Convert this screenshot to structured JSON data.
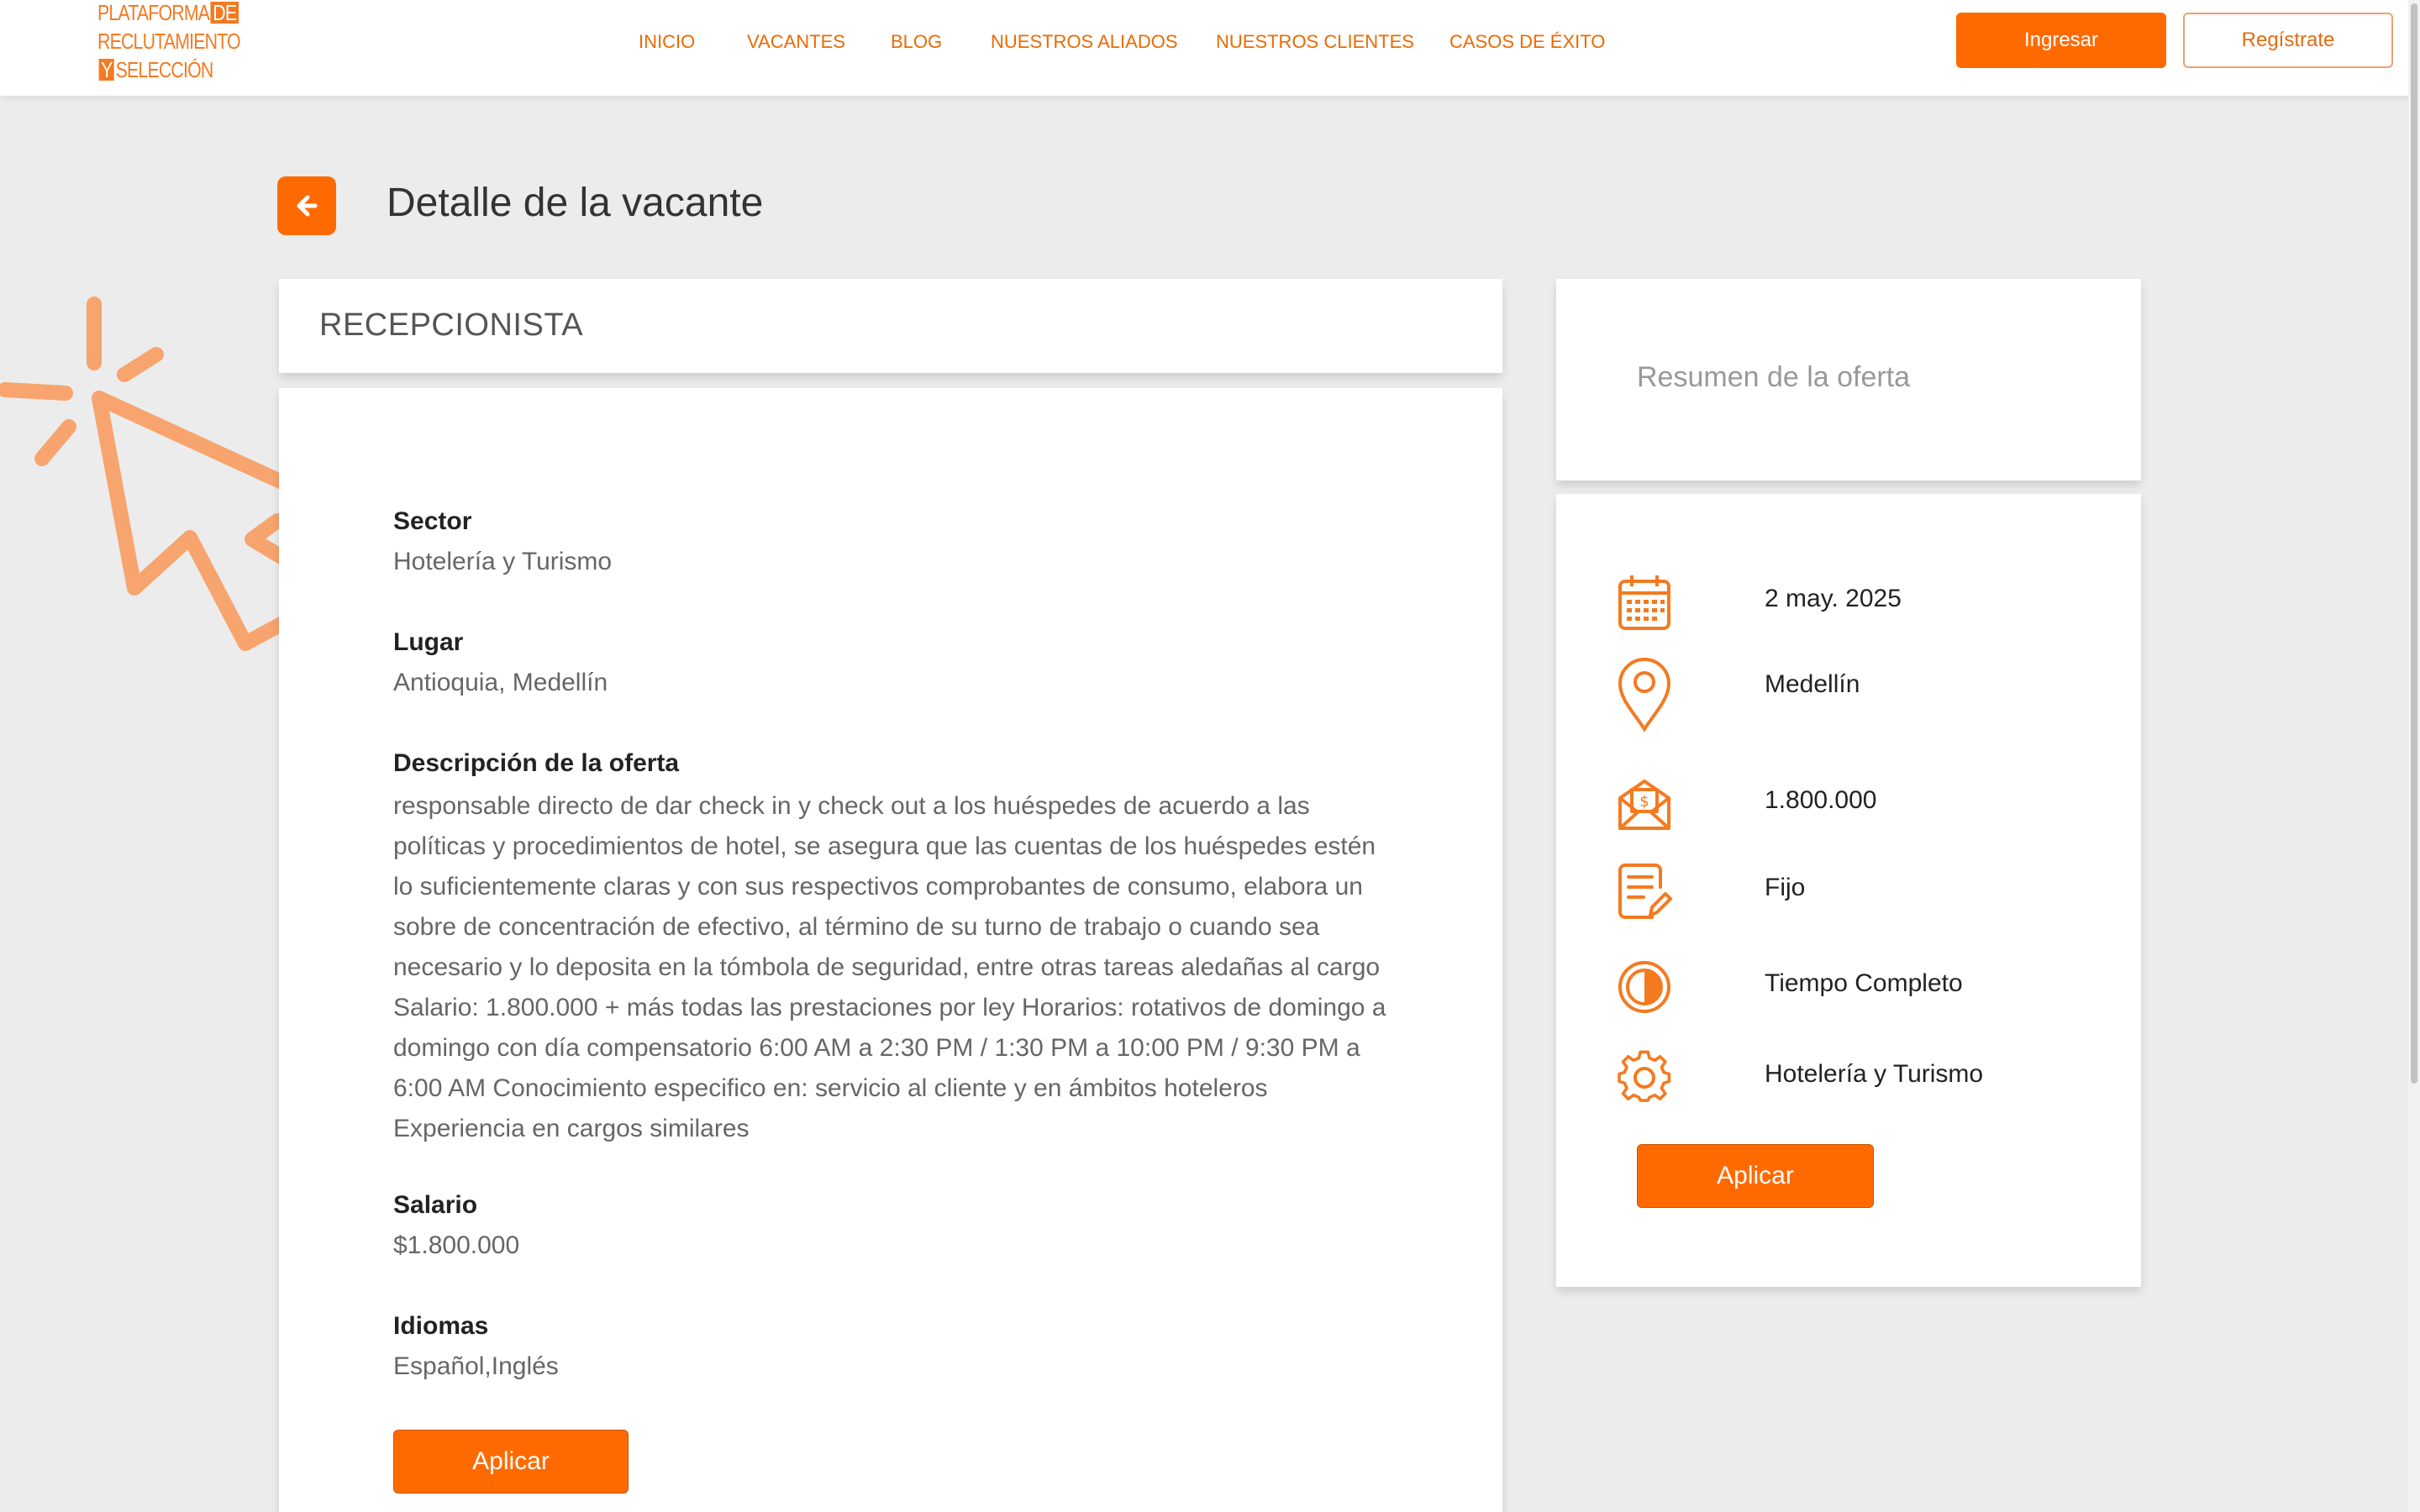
{
  "brand": {
    "logo_line1": "PLATAFORMA",
    "logo_de": "DE",
    "logo_line2": "RECLUTAMIENTO",
    "logo_y": "Y",
    "logo_line3": "SELECCIÓN"
  },
  "nav": {
    "items": [
      "INICIO",
      "VACANTES",
      "BLOG",
      "NUESTROS ALIADOS",
      "NUESTROS CLIENTES",
      "CASOS DE ÉXITO"
    ]
  },
  "header": {
    "login_label": "Ingresar",
    "register_label": "Regístrate"
  },
  "page": {
    "title": "Detalle de la vacante"
  },
  "job": {
    "title": "RECEPCIONISTA",
    "sector_label": "Sector",
    "sector_value": "Hotelería y Turismo",
    "place_label": "Lugar",
    "place_value": "Antioquia, Medellín",
    "desc_label": "Descripción de la oferta",
    "desc_value": "responsable directo de dar check in y check out a los huéspedes de acuerdo a las políticas y procedimientos de hotel, se asegura que las cuentas de los huéspedes estén lo suficientemente claras y con sus respectivos comprobantes de consumo, elabora un sobre de concentración de efectivo, al término de su turno de trabajo o cuando sea necesario y lo deposita en la tómbola de seguridad, entre otras tareas aledañas al cargo Salario: 1.800.000 + más todas las prestaciones por ley Horarios: rotativos de domingo a domingo con día compensatorio 6:00 AM a 2:30 PM / 1:30 PM a 10:00 PM / 9:30 PM a 6:00 AM Conocimiento especifico en: servicio al cliente y en ámbitos hoteleros Experiencia en cargos similares",
    "salary_label": "Salario",
    "salary_value": "$1.800.000",
    "languages_label": "Idiomas",
    "languages_value": "Español,Inglés",
    "apply_label": "Aplicar"
  },
  "summary": {
    "heading": "Resumen de la oferta",
    "date": "2 may. 2025",
    "city": "Medellín",
    "salary": "1.800.000",
    "contract": "Fijo",
    "schedule": "Tiempo Completo",
    "sector": "Hotelería y Turismo",
    "apply_label": "Aplicar"
  },
  "colors": {
    "accent": "#ff6a00",
    "nav_text": "#ec6a00",
    "background": "#ececec"
  },
  "icons": {
    "back": "arrow-left-icon",
    "date": "calendar-icon",
    "city": "map-pin-icon",
    "salary": "money-envelope-icon",
    "contract": "document-edit-icon",
    "schedule": "half-circle-icon",
    "sector": "gear-icon"
  }
}
